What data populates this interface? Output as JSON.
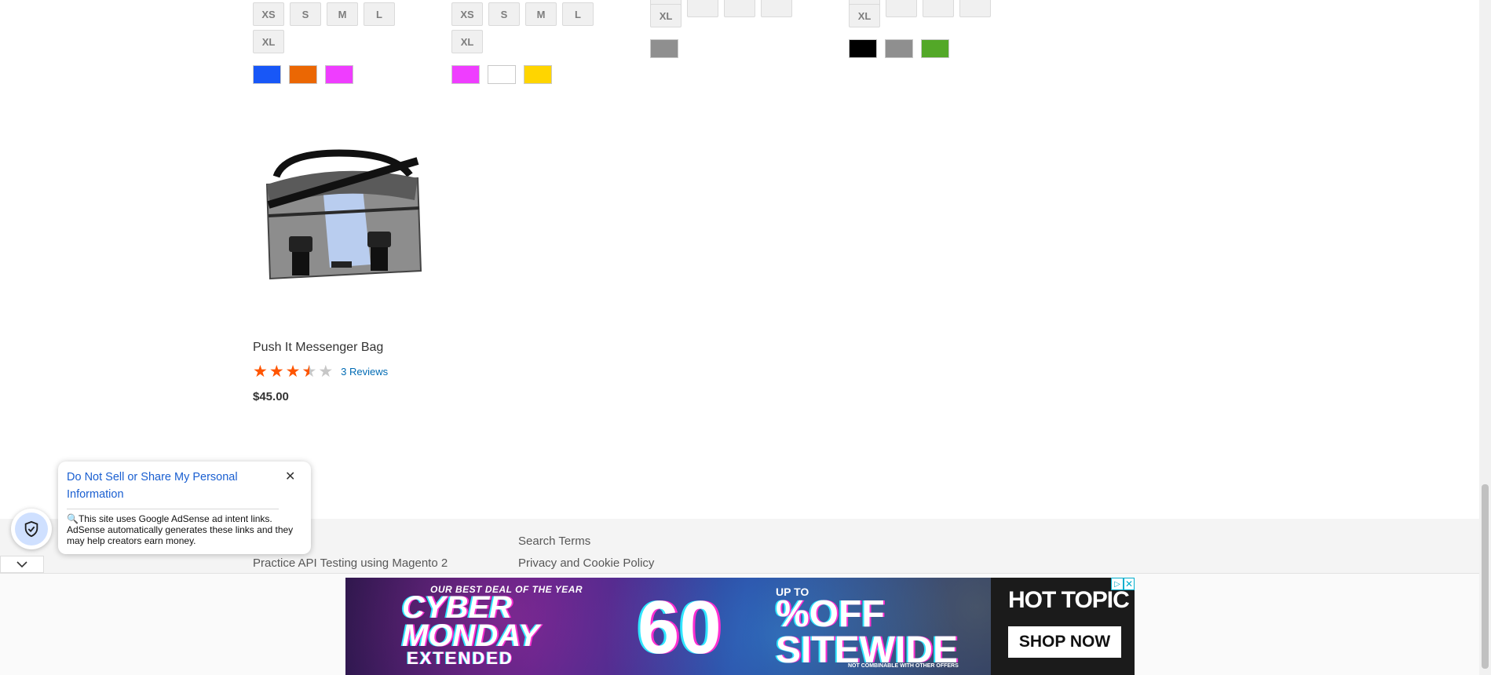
{
  "product_grid": {
    "columns": [
      {
        "sizes_row1": [
          "XS",
          "S",
          "M",
          "L"
        ],
        "sizes_row2": [
          "XL"
        ],
        "colors": [
          "#1857f7",
          "#eb6703",
          "#ef3dff"
        ]
      },
      {
        "sizes_row1": [
          "XS",
          "S",
          "M",
          "L"
        ],
        "sizes_row2": [
          "XL"
        ],
        "colors": [
          "#ef3dff",
          "#ffffff",
          "#ffd500"
        ]
      },
      {
        "sizes_row2": [
          "XL"
        ],
        "colors": [
          "#8f8f8f"
        ]
      },
      {
        "sizes_row2": [
          "XL"
        ],
        "colors": [
          "#000000",
          "#8f8f8f",
          "#53a828"
        ]
      }
    ]
  },
  "product": {
    "name": "Push It Messenger Bag",
    "rating_fraction": 0.6,
    "stars": [
      "★",
      "★",
      "★",
      "★",
      "★"
    ],
    "reviews_label": "3 Reviews",
    "price": "$45.00"
  },
  "footer": {
    "links": [
      "Practice API Testing using Magento 2",
      "Search Terms",
      "Privacy and Cookie Policy"
    ]
  },
  "privacy_popup": {
    "title": "Do Not Sell or Share My Personal Information",
    "close_glyph": "✕",
    "body": "🔍This site uses Google AdSense ad intent links. AdSense automatically generates these links and they may help creators earn money.",
    "collapse_glyph": "⌄"
  },
  "ad": {
    "eyebrow": "OUR BEST DEAL OF THE YEAR",
    "headline": "CYBER\nMONDAY",
    "sub": "EXTENDED",
    "up_to": "UP TO",
    "percent": "60",
    "off": "%OFF\nSITEWIDE",
    "fine_print": "NOT COMBINABLE WITH OTHER OFFERS",
    "brand": "HOT TOPIC",
    "cta": "SHOP NOW",
    "choices_glyph": "▷",
    "close_glyph": "✕",
    "colors": {
      "accent_pink": "#ff2fd0",
      "accent_cyan": "#2fe6ff"
    }
  },
  "colors": {
    "star_fill": "#ff5501",
    "link": "#006bb4",
    "privacy_title": "#1a5fd1"
  }
}
